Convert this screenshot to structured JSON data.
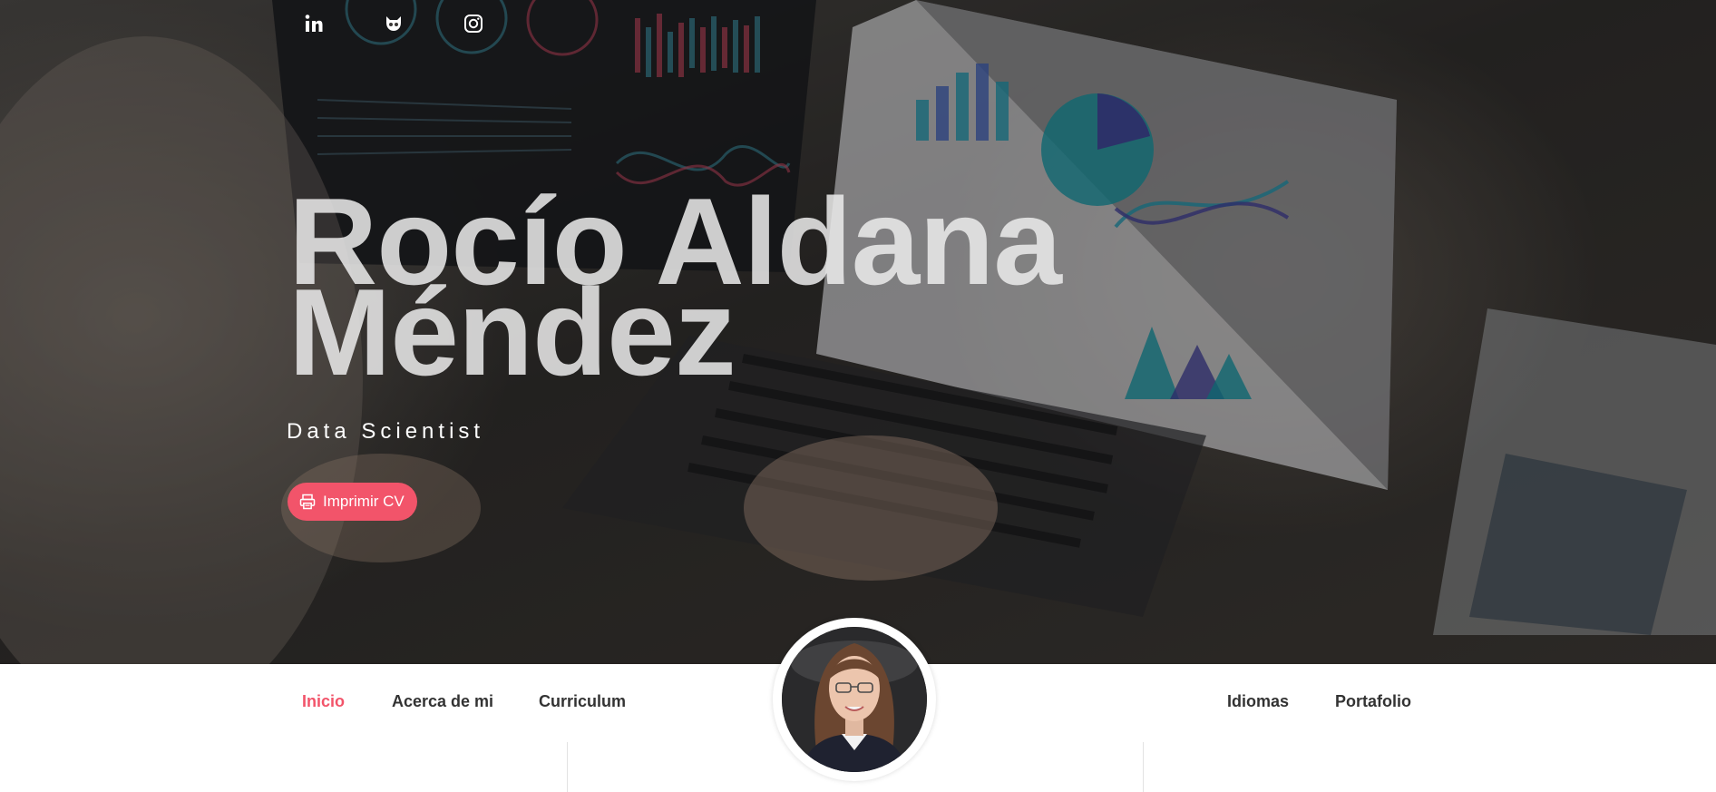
{
  "hero": {
    "name_line1": "Rocío Aldana",
    "name_line2": "Méndez",
    "role": "Data Scientist",
    "print_label": "Imprimir CV"
  },
  "social": [
    {
      "icon": "linkedin-icon"
    },
    {
      "icon": "github-icon"
    },
    {
      "icon": "instagram-icon"
    }
  ],
  "nav": {
    "left": [
      "Inicio",
      "Acerca de mi",
      "Curriculum"
    ],
    "right": [
      "Idiomas",
      "Portafolio"
    ],
    "active": "Inicio"
  },
  "colors": {
    "accent": "#f2546a",
    "nav_text": "#333333"
  }
}
